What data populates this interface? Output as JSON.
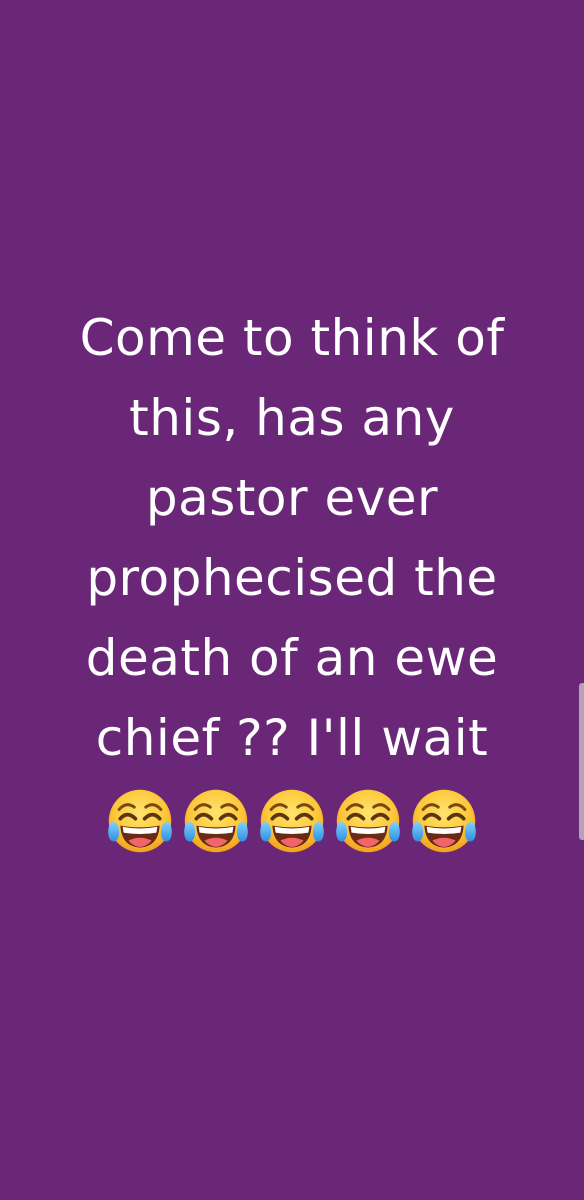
{
  "post": {
    "background_color": "#6a2778",
    "text_color": "#ffffff",
    "lines": [
      "Come to think of",
      "this, has any",
      "pastor ever",
      "prophecised the",
      "death of an ewe",
      "chief ?? I'll wait"
    ],
    "emoji": {
      "name": "face-with-tears-of-joy-icon",
      "count": 5
    }
  }
}
